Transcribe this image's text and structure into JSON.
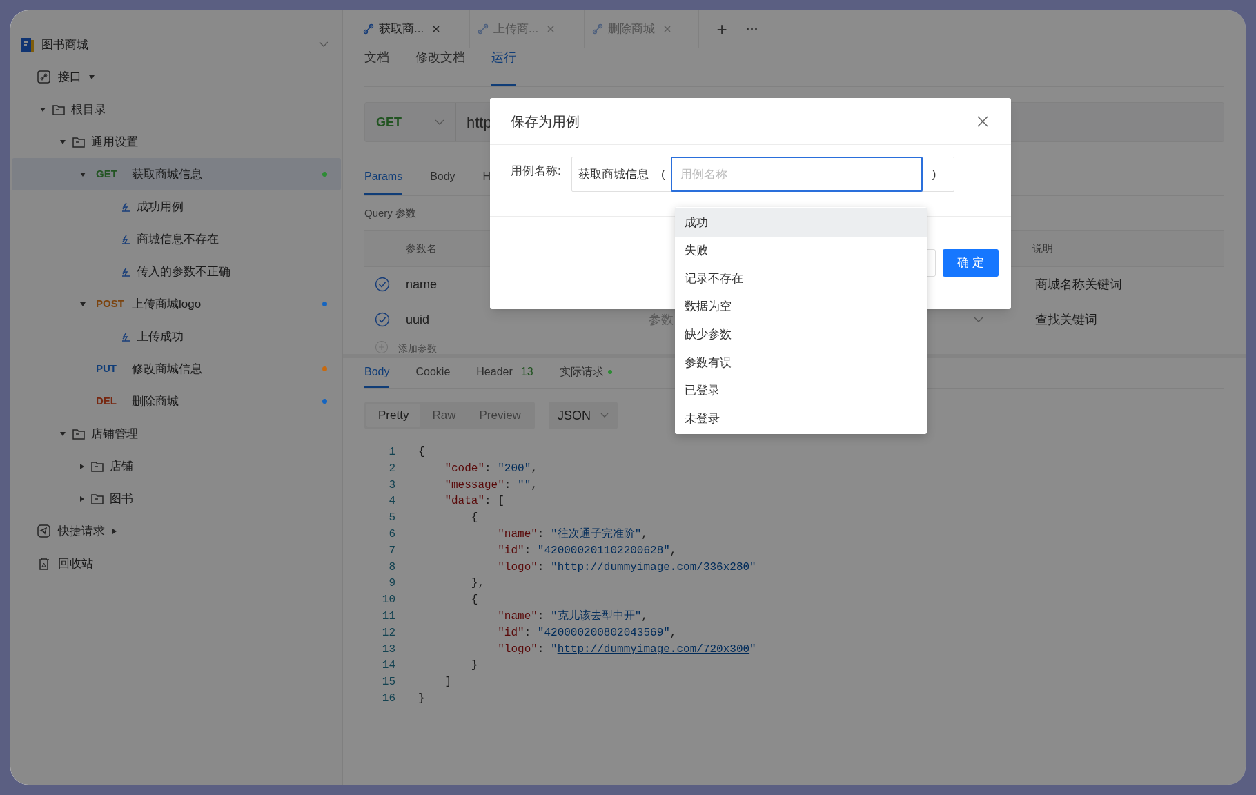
{
  "sidebar": {
    "project": {
      "title": "图书商城"
    },
    "sections": [
      {
        "kind": "interfaces",
        "label": "接口",
        "expanded": true,
        "children": [
          {
            "kind": "folder",
            "label": "根目录",
            "expanded": true,
            "children": [
              {
                "kind": "folder",
                "label": "通用设置",
                "expanded": true,
                "children": [
                  {
                    "kind": "api",
                    "method": "GET",
                    "label": "获取商城信息",
                    "selected": true,
                    "expanded": true,
                    "color": "#2e8b35",
                    "children": [
                      {
                        "kind": "case",
                        "label": "成功用例"
                      },
                      {
                        "kind": "case",
                        "label": "商城信息不存在"
                      },
                      {
                        "kind": "case",
                        "label": "传入的参数不正确"
                      }
                    ]
                  },
                  {
                    "kind": "api",
                    "method": "POST",
                    "label": "上传商城logo",
                    "selected": false,
                    "expanded": true,
                    "color": "#1565c0",
                    "children": [
                      {
                        "kind": "case",
                        "label": "上传成功"
                      }
                    ]
                  },
                  {
                    "kind": "api",
                    "method": "PUT",
                    "label": "修改商城信息",
                    "selected": false,
                    "color": "#c76a10"
                  },
                  {
                    "kind": "api",
                    "method": "DEL",
                    "label": "删除商城",
                    "selected": false,
                    "color": "#1565c0"
                  }
                ]
              },
              {
                "kind": "folder",
                "label": "店铺管理",
                "expanded": true,
                "children": [
                  {
                    "kind": "folder",
                    "label": "店铺",
                    "expanded": false
                  },
                  {
                    "kind": "folder",
                    "label": "图书",
                    "expanded": false
                  }
                ]
              }
            ]
          }
        ]
      },
      {
        "kind": "quick",
        "label": "快捷请求",
        "expanded": false
      },
      {
        "kind": "trash",
        "label": "回收站"
      }
    ]
  },
  "tabs": [
    {
      "label": "获取商...",
      "selected": true
    },
    {
      "label": "上传商...",
      "selected": false
    },
    {
      "label": "删除商城",
      "selected": false
    }
  ],
  "tab_actions": {
    "add": "+",
    "more": "···"
  },
  "sub_tabs": [
    {
      "label": "文档",
      "selected": false
    },
    {
      "label": "修改文档",
      "selected": false
    },
    {
      "label": "运行",
      "selected": true
    }
  ],
  "request": {
    "method": "GET",
    "url": "http"
  },
  "param_tabs": [
    {
      "label": "Params",
      "selected": true
    },
    {
      "label": "Body",
      "selected": false
    },
    {
      "label": "H",
      "selected": false
    }
  ],
  "query_title": "Query 参数",
  "params_table": {
    "columns": [
      "参数名",
      "说明"
    ],
    "rows": [
      {
        "checked": true,
        "name": "name",
        "value": "",
        "description": "商城名称关键词"
      },
      {
        "checked": true,
        "name": "uuid",
        "value": "参数",
        "description": "查找关键词"
      }
    ],
    "add_row": "添加参数"
  },
  "response_tabs": [
    {
      "label": "Body",
      "selected": true
    },
    {
      "label": "Cookie",
      "selected": false
    },
    {
      "label": "Header",
      "count": "13",
      "selected": false
    },
    {
      "label": "实际请求",
      "selected": false,
      "color": "#2e8b35"
    }
  ],
  "view_modes": [
    {
      "label": "Pretty",
      "selected": true
    },
    {
      "label": "Raw",
      "selected": false
    },
    {
      "label": "Preview",
      "selected": false
    }
  ],
  "format": "JSON",
  "code": [
    {
      "number": "1",
      "tokens": [
        {
          "kind": "punct",
          "text": "{"
        }
      ]
    },
    {
      "number": "2",
      "tokens": [
        {
          "kind": "key",
          "text": "    \"code\""
        },
        {
          "kind": "punct",
          "text": ": "
        },
        {
          "kind": "string",
          "text": "\"200\""
        },
        {
          "kind": "punct",
          "text": ","
        }
      ]
    },
    {
      "number": "3",
      "tokens": [
        {
          "kind": "key",
          "text": "    \"message\""
        },
        {
          "kind": "punct",
          "text": ": "
        },
        {
          "kind": "string",
          "text": "\"\""
        },
        {
          "kind": "punct",
          "text": ","
        }
      ]
    },
    {
      "number": "4",
      "tokens": [
        {
          "kind": "key",
          "text": "    \"data\""
        },
        {
          "kind": "punct",
          "text": ": ["
        }
      ]
    },
    {
      "number": "5",
      "tokens": [
        {
          "kind": "punct",
          "text": "        {"
        }
      ]
    },
    {
      "number": "6",
      "tokens": [
        {
          "kind": "key",
          "text": "            \"name\""
        },
        {
          "kind": "punct",
          "text": ": "
        },
        {
          "kind": "string",
          "text": "\"往次通子完准阶\""
        },
        {
          "kind": "punct",
          "text": ","
        }
      ]
    },
    {
      "number": "7",
      "tokens": [
        {
          "kind": "key",
          "text": "            \"id\""
        },
        {
          "kind": "punct",
          "text": ": "
        },
        {
          "kind": "string",
          "text": "\"420000201102200628\""
        },
        {
          "kind": "punct",
          "text": ","
        }
      ]
    },
    {
      "number": "8",
      "tokens": [
        {
          "kind": "key",
          "text": "            \"logo\""
        },
        {
          "kind": "punct",
          "text": ": "
        },
        {
          "kind": "string",
          "text": "\""
        },
        {
          "kind": "link",
          "text": "http://dummyimage.com/336x280"
        },
        {
          "kind": "string",
          "text": "\""
        }
      ]
    },
    {
      "number": "9",
      "tokens": [
        {
          "kind": "punct",
          "text": "        },"
        }
      ]
    },
    {
      "number": "10",
      "tokens": [
        {
          "kind": "punct",
          "text": "        {"
        }
      ]
    },
    {
      "number": "11",
      "tokens": [
        {
          "kind": "key",
          "text": "            \"name\""
        },
        {
          "kind": "punct",
          "text": ": "
        },
        {
          "kind": "string",
          "text": "\"克儿该去型中开\""
        },
        {
          "kind": "punct",
          "text": ","
        }
      ]
    },
    {
      "number": "12",
      "tokens": [
        {
          "kind": "key",
          "text": "            \"id\""
        },
        {
          "kind": "punct",
          "text": ": "
        },
        {
          "kind": "string",
          "text": "\"420000200802043569\""
        },
        {
          "kind": "punct",
          "text": ","
        }
      ]
    },
    {
      "number": "13",
      "tokens": [
        {
          "kind": "key",
          "text": "            \"logo\""
        },
        {
          "kind": "punct",
          "text": ": "
        },
        {
          "kind": "string",
          "text": "\""
        },
        {
          "kind": "link",
          "text": "http://dummyimage.com/720x300"
        },
        {
          "kind": "string",
          "text": "\""
        }
      ]
    },
    {
      "number": "14",
      "tokens": [
        {
          "kind": "punct",
          "text": "        }"
        }
      ]
    },
    {
      "number": "15",
      "tokens": [
        {
          "kind": "punct",
          "text": "    ]"
        }
      ]
    },
    {
      "number": "16",
      "tokens": [
        {
          "kind": "punct",
          "text": "}"
        }
      ]
    }
  ],
  "dialog": {
    "title": "保存为用例",
    "field_label": "用例名称:",
    "prefix": "获取商城信息",
    "open_paren": "(",
    "placeholder": "用例名称",
    "close_paren": ")",
    "confirm": "确 定",
    "suggestions": [
      {
        "label": "成功",
        "selected": true
      },
      {
        "label": "失败",
        "selected": false
      },
      {
        "label": "记录不存在",
        "selected": false
      },
      {
        "label": "数据为空",
        "selected": false
      },
      {
        "label": "缺少参数",
        "selected": false
      },
      {
        "label": "参数有误",
        "selected": false
      },
      {
        "label": "已登录",
        "selected": false
      },
      {
        "label": "未登录",
        "selected": false
      }
    ]
  }
}
